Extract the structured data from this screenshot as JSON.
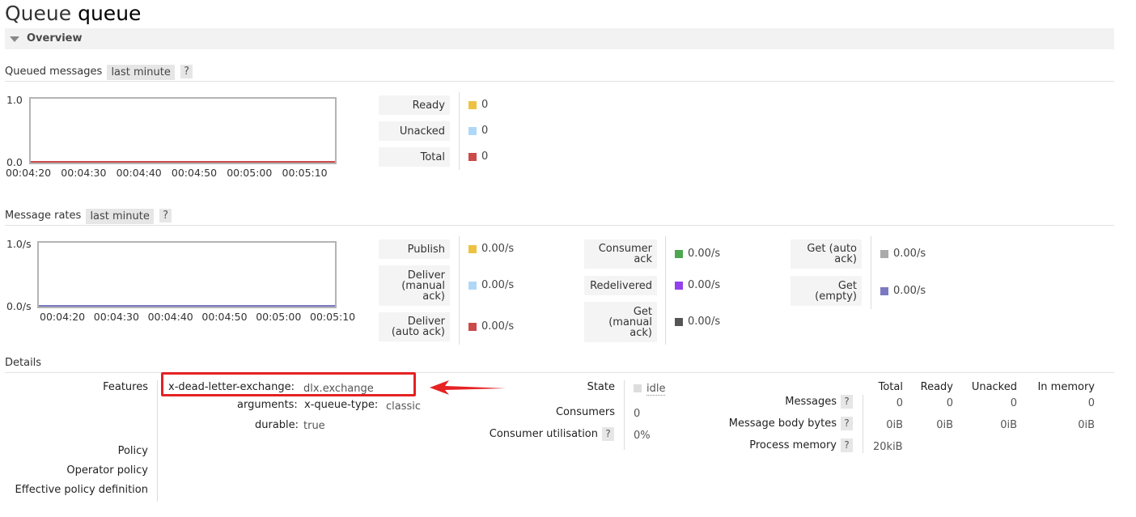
{
  "page": {
    "title_prefix": "Queue",
    "title_name": "queue",
    "overview_label": "Overview"
  },
  "queued_messages": {
    "label": "Queued messages",
    "range": "last minute",
    "help": "?",
    "y_max": "1.0",
    "y_min": "0.0",
    "x_ticks": [
      "00:04:20",
      "00:04:30",
      "00:04:40",
      "00:04:50",
      "00:05:00",
      "00:05:10"
    ],
    "legend": [
      {
        "label": "Ready",
        "color": "#edc240",
        "value": "0"
      },
      {
        "label": "Unacked",
        "color": "#afd8f8",
        "value": "0"
      },
      {
        "label": "Total",
        "color": "#cb4b4b",
        "value": "0"
      }
    ]
  },
  "message_rates": {
    "label": "Message rates",
    "range": "last minute",
    "help": "?",
    "y_max": "1.0/s",
    "y_min": "0.0/s",
    "x_ticks": [
      "00:04:20",
      "00:04:30",
      "00:04:40",
      "00:04:50",
      "00:05:00",
      "00:05:10"
    ],
    "col1": [
      {
        "label": "Publish",
        "color": "#edc240",
        "value": "0.00/s"
      },
      {
        "label": "Deliver (manual ack)",
        "color": "#afd8f8",
        "value": "0.00/s"
      },
      {
        "label": "Deliver (auto ack)",
        "color": "#cb4b4b",
        "value": "0.00/s"
      }
    ],
    "col2": [
      {
        "label": "Consumer ack",
        "color": "#4da74d",
        "value": "0.00/s"
      },
      {
        "label": "Redelivered",
        "color": "#9440ed",
        "value": "0.00/s"
      },
      {
        "label": "Get (manual ack)",
        "color": "#555555",
        "value": "0.00/s"
      }
    ],
    "col3": [
      {
        "label": "Get (auto ack)",
        "color": "#aaaaaa",
        "value": "0.00/s"
      },
      {
        "label": "Get (empty)",
        "color": "#7c79c3",
        "value": "0.00/s"
      }
    ]
  },
  "details": {
    "label": "Details",
    "features_label": "Features",
    "args_label": "arguments:",
    "dlx_key": "x-dead-letter-exchange:",
    "dlx_value": "dlx.exchange",
    "qtype_key": "x-queue-type:",
    "qtype_value": "classic",
    "durable_key": "durable:",
    "durable_value": "true",
    "policy_label": "Policy",
    "operator_policy_label": "Operator policy",
    "effective_policy_label": "Effective policy definition",
    "state_label": "State",
    "state_value": "idle",
    "consumers_label": "Consumers",
    "consumers_value": "0",
    "consumer_util_label": "Consumer utilisation",
    "consumer_util_value": "0%",
    "help": "?",
    "stats_headers": [
      "Total",
      "Ready",
      "Unacked",
      "In memory"
    ],
    "messages_label": "Messages",
    "messages_values": [
      "0",
      "0",
      "0",
      "0"
    ],
    "body_bytes_label": "Message body bytes",
    "body_bytes_values": [
      "0iB",
      "0iB",
      "0iB",
      "0iB"
    ],
    "process_memory_label": "Process memory",
    "process_memory_value": "20kiB"
  },
  "annotation": {
    "color": "#e52224"
  }
}
